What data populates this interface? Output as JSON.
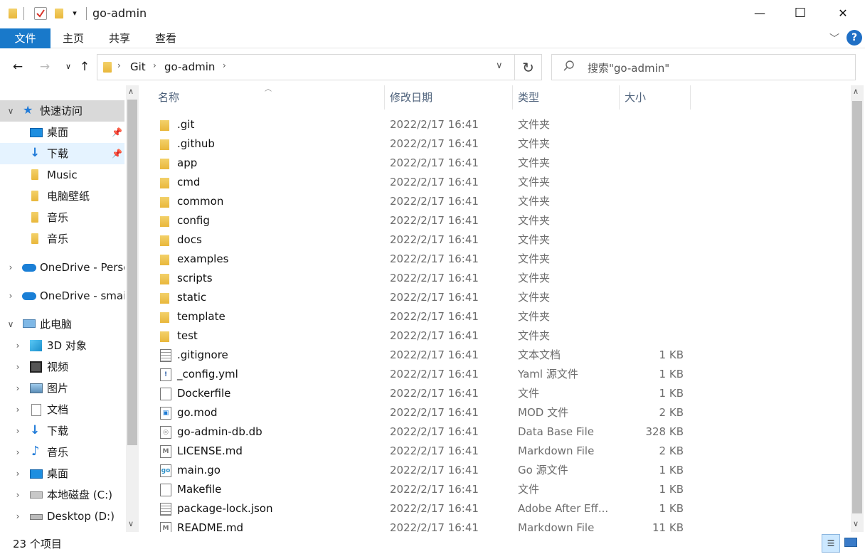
{
  "window": {
    "title": "go-admin",
    "minimize": "—",
    "maximize": "☐",
    "close": "✕"
  },
  "ribbon": {
    "tabs": [
      "文件",
      "主页",
      "共享",
      "查看"
    ]
  },
  "nav": {
    "breadcrumb": [
      "Git",
      "go-admin"
    ],
    "search_placeholder": "搜索\"go-admin\""
  },
  "sidebar": {
    "quick_access": "快速访问",
    "quick_items": [
      "桌面",
      "下载",
      "Music",
      "电脑壁纸",
      "音乐",
      "音乐"
    ],
    "onedrive1": "OneDrive - Perso",
    "onedrive2": "OneDrive - smail",
    "this_pc": "此电脑",
    "pc_items": [
      "3D 对象",
      "视频",
      "图片",
      "文档",
      "下载",
      "音乐",
      "桌面",
      "本地磁盘 (C:)",
      "Desktop (D:)"
    ]
  },
  "columns": {
    "name": "名称",
    "date": "修改日期",
    "type": "类型",
    "size": "大小"
  },
  "files": [
    {
      "name": ".git",
      "date": "2022/2/17 16:41",
      "type": "文件夹",
      "size": "",
      "kind": "folder"
    },
    {
      "name": ".github",
      "date": "2022/2/17 16:41",
      "type": "文件夹",
      "size": "",
      "kind": "folder"
    },
    {
      "name": "app",
      "date": "2022/2/17 16:41",
      "type": "文件夹",
      "size": "",
      "kind": "folder"
    },
    {
      "name": "cmd",
      "date": "2022/2/17 16:41",
      "type": "文件夹",
      "size": "",
      "kind": "folder"
    },
    {
      "name": "common",
      "date": "2022/2/17 16:41",
      "type": "文件夹",
      "size": "",
      "kind": "folder"
    },
    {
      "name": "config",
      "date": "2022/2/17 16:41",
      "type": "文件夹",
      "size": "",
      "kind": "folder"
    },
    {
      "name": "docs",
      "date": "2022/2/17 16:41",
      "type": "文件夹",
      "size": "",
      "kind": "folder"
    },
    {
      "name": "examples",
      "date": "2022/2/17 16:41",
      "type": "文件夹",
      "size": "",
      "kind": "folder"
    },
    {
      "name": "scripts",
      "date": "2022/2/17 16:41",
      "type": "文件夹",
      "size": "",
      "kind": "folder"
    },
    {
      "name": "static",
      "date": "2022/2/17 16:41",
      "type": "文件夹",
      "size": "",
      "kind": "folder"
    },
    {
      "name": "template",
      "date": "2022/2/17 16:41",
      "type": "文件夹",
      "size": "",
      "kind": "folder"
    },
    {
      "name": "test",
      "date": "2022/2/17 16:41",
      "type": "文件夹",
      "size": "",
      "kind": "folder"
    },
    {
      "name": ".gitignore",
      "date": "2022/2/17 16:41",
      "type": "文本文档",
      "size": "1 KB",
      "kind": "text"
    },
    {
      "name": "_config.yml",
      "date": "2022/2/17 16:41",
      "type": "Yaml 源文件",
      "size": "1 KB",
      "kind": "yaml"
    },
    {
      "name": "Dockerfile",
      "date": "2022/2/17 16:41",
      "type": "文件",
      "size": "1 KB",
      "kind": "file"
    },
    {
      "name": "go.mod",
      "date": "2022/2/17 16:41",
      "type": "MOD 文件",
      "size": "2 KB",
      "kind": "mod"
    },
    {
      "name": "go-admin-db.db",
      "date": "2022/2/17 16:41",
      "type": "Data Base File",
      "size": "328 KB",
      "kind": "db"
    },
    {
      "name": "LICENSE.md",
      "date": "2022/2/17 16:41",
      "type": "Markdown File",
      "size": "2 KB",
      "kind": "md"
    },
    {
      "name": "main.go",
      "date": "2022/2/17 16:41",
      "type": "Go 源文件",
      "size": "1 KB",
      "kind": "go"
    },
    {
      "name": "Makefile",
      "date": "2022/2/17 16:41",
      "type": "文件",
      "size": "1 KB",
      "kind": "file"
    },
    {
      "name": "package-lock.json",
      "date": "2022/2/17 16:41",
      "type": "Adobe After Eff...",
      "size": "1 KB",
      "kind": "json"
    },
    {
      "name": "README.md",
      "date": "2022/2/17 16:41",
      "type": "Markdown File",
      "size": "11 KB",
      "kind": "md"
    }
  ],
  "status": {
    "count": "23 个项目"
  },
  "colors": {
    "file_tab": "#1979ca",
    "selection": "#cce8ff",
    "header_text": "#4c607a",
    "folder": "#e9b73b"
  }
}
